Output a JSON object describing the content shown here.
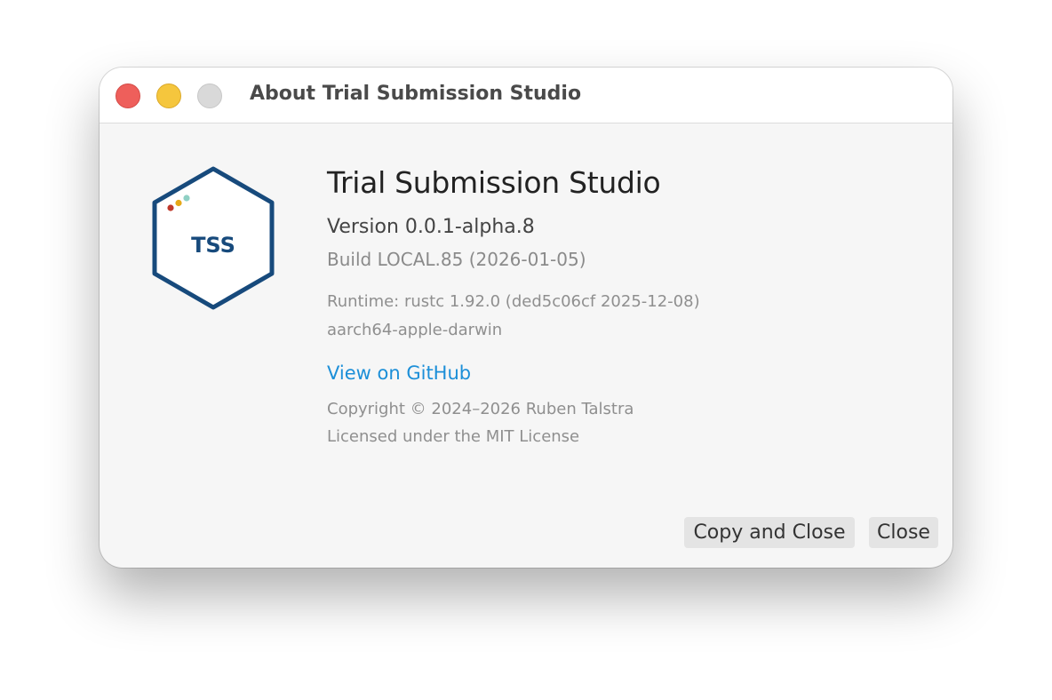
{
  "window": {
    "title": "About Trial Submission Studio"
  },
  "logo": {
    "text": "TSS",
    "hex_color": "#174a7c",
    "dot_colors": [
      "#c0392b",
      "#e6a817",
      "#8fd0c4"
    ]
  },
  "about": {
    "app_name": "Trial Submission Studio",
    "version": "Version 0.0.1-alpha.8",
    "build": "Build LOCAL.85 (2026-01-05)",
    "runtime": "Runtime: rustc 1.92.0 (ded5c06cf 2025-12-08)",
    "target": "aarch64-apple-darwin",
    "github_link": "View on GitHub",
    "copyright": "Copyright © 2024–2026 Ruben Talstra",
    "license": "Licensed under the MIT License"
  },
  "buttons": {
    "copy_and_close": "Copy and Close",
    "close": "Close"
  },
  "colors": {
    "link": "#1c8fd8",
    "close_light": "#ee5f5b",
    "minimize_light": "#f5c63d",
    "zoom_light": "#d9d9d9"
  }
}
